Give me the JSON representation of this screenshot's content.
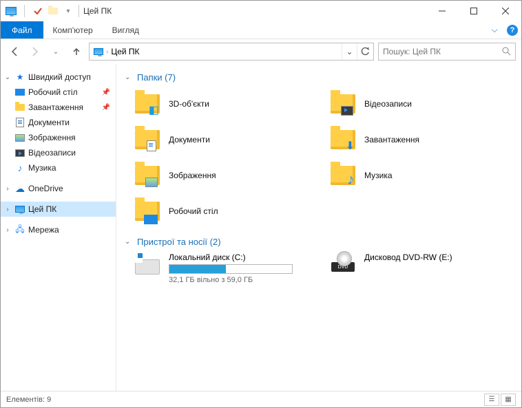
{
  "window": {
    "title": "Цей ПК"
  },
  "ribbon": {
    "file": "Файл",
    "tabs": [
      "Комп'ютер",
      "Вигляд"
    ]
  },
  "address": {
    "crumb": "Цей ПК"
  },
  "search": {
    "placeholder": "Пошук: Цей ПК"
  },
  "sidebar": {
    "quick": "Швидкий доступ",
    "items": [
      "Робочий стіл",
      "Завантаження",
      "Документи",
      "Зображення",
      "Відеозаписи",
      "Музика"
    ],
    "onedrive": "OneDrive",
    "thispc": "Цей ПК",
    "network": "Мережа"
  },
  "groups": {
    "folders": {
      "title": "Папки (7)"
    },
    "devices": {
      "title": "Пристрої та носії (2)"
    }
  },
  "folders": [
    "3D-об'єкти",
    "Відеозаписи",
    "Документи",
    "Завантаження",
    "Зображення",
    "Музика",
    "Робочий стіл"
  ],
  "drives": {
    "c": {
      "name": "Локальний диск (C:)",
      "sub": "32,1 ГБ вільно з 59,0 ГБ",
      "percent_used": 46
    },
    "dvd": {
      "name": "Дисковод DVD-RW (E:)",
      "label": "DVD"
    }
  },
  "status": {
    "text": "Елементів: 9"
  }
}
